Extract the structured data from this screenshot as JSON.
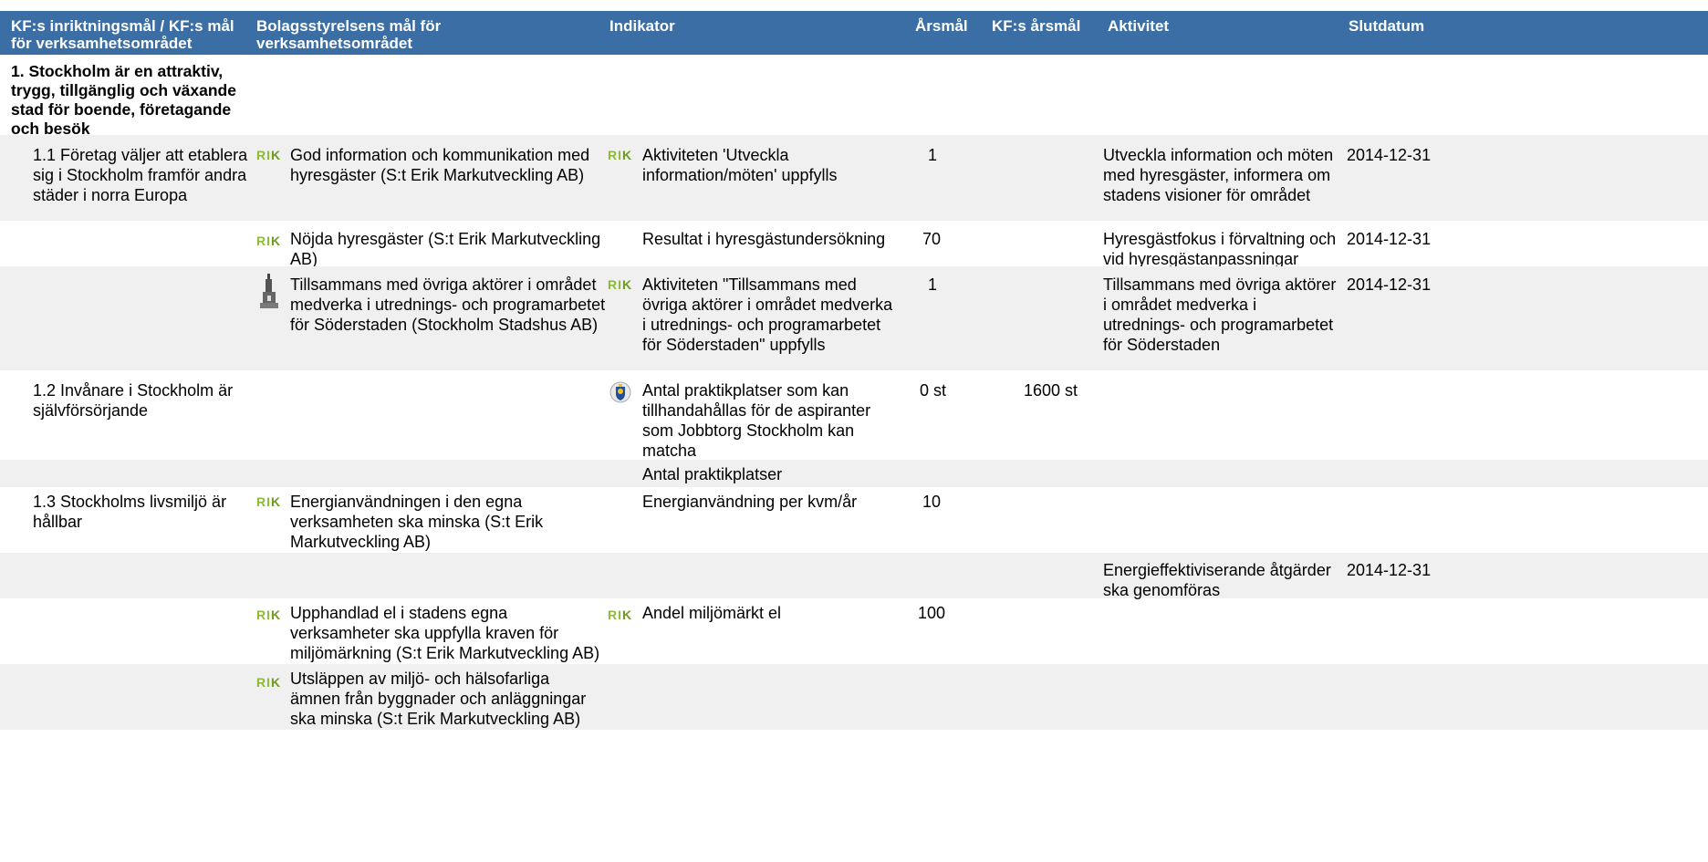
{
  "header": {
    "col1": "KF:s inriktningsmål / KF:s mål för verksamhetsområdet",
    "col2": "Bolagsstyrelsens mål för verksamhetsområdet",
    "col3": "Indikator",
    "col4": "Årsmål",
    "col5": "KF:s årsmål",
    "col6": "Aktivitet",
    "col7": "Slutdatum"
  },
  "colors": {
    "header_bg": "#3a6ea5",
    "alt_row": "#f0f0f0",
    "rik_logo": "#8eb93a"
  },
  "icons": {
    "rik": "rik-logo",
    "city_hall": "stadshus-icon",
    "city_crest": "stockholm-crest-icon"
  },
  "section": {
    "title": "1. Stockholm är en attraktiv, trygg, tillgänglig och växande stad för boende, företagande och besök"
  },
  "rows": [
    {
      "kf_goal": "1.1 Företag väljer att etablera sig i Stockholm framför andra städer i norra Europa",
      "board_goal": "God information och kommunikation med hyresgäster (S:t Erik Markutveckling AB)",
      "indicator": "Aktiviteten 'Utveckla information/möten' uppfylls",
      "year_target": "1",
      "kf_year_target": "",
      "activity": "Utveckla information och möten med hyresgäster, informera om stadens visioner för området",
      "end_date": "2014-12-31"
    },
    {
      "kf_goal": "",
      "board_goal": "Nöjda hyresgäster (S:t Erik Markutveckling AB)",
      "indicator": "Resultat i hyresgästundersökning",
      "year_target": "70",
      "kf_year_target": "",
      "activity": "Hyresgästfokus i förvaltning och vid hyresgästanpassningar",
      "end_date": "2014-12-31"
    },
    {
      "kf_goal": "",
      "board_goal": "Tillsammans med övriga aktörer i området medverka i utrednings- och programarbetet för Söderstaden (Stockholm Stadshus AB)",
      "indicator": "Aktiviteten \"Tillsammans med övriga aktörer i området medverka i utrednings- och programarbetet för Söderstaden\" uppfylls",
      "year_target": "1",
      "kf_year_target": "",
      "activity": "Tillsammans med övriga aktörer i området medverka i utrednings- och programarbetet för Söderstaden",
      "end_date": "2014-12-31"
    },
    {
      "kf_goal": "1.2 Invånare i Stockholm är självförsörjande",
      "board_goal": "",
      "indicator": "Antal praktikplatser som kan tillhandahållas för de aspiranter som Jobbtorg Stockholm kan matcha",
      "year_target": "0 st",
      "kf_year_target": "1600 st",
      "activity": "",
      "end_date": ""
    },
    {
      "kf_goal": "",
      "board_goal": "",
      "indicator": "Antal praktikplatser",
      "year_target": "",
      "kf_year_target": "",
      "activity": "",
      "end_date": ""
    },
    {
      "kf_goal": "1.3 Stockholms livsmiljö är hållbar",
      "board_goal": "Energianvändningen i den egna verksamheten ska minska (S:t Erik Markutveckling AB)",
      "indicator": "Energianvändning per kvm/år",
      "year_target": "10",
      "kf_year_target": "",
      "activity": "",
      "end_date": ""
    },
    {
      "kf_goal": "",
      "board_goal": "",
      "indicator": "",
      "year_target": "",
      "kf_year_target": "",
      "activity": "Energieffektiviserande åtgärder ska genomföras",
      "end_date": "2014-12-31"
    },
    {
      "kf_goal": "",
      "board_goal": "Upphandlad el i stadens egna verksamheter ska uppfylla kraven för miljömärkning (S:t Erik Markutveckling AB)",
      "indicator": "Andel miljömärkt el",
      "year_target": "100",
      "kf_year_target": "",
      "activity": "",
      "end_date": ""
    },
    {
      "kf_goal": "",
      "board_goal": "Utsläppen av miljö- och hälsofarliga ämnen från byggnader och anläggningar ska minska (S:t Erik Markutveckling AB)",
      "indicator": "",
      "year_target": "",
      "kf_year_target": "",
      "activity": "",
      "end_date": ""
    }
  ]
}
